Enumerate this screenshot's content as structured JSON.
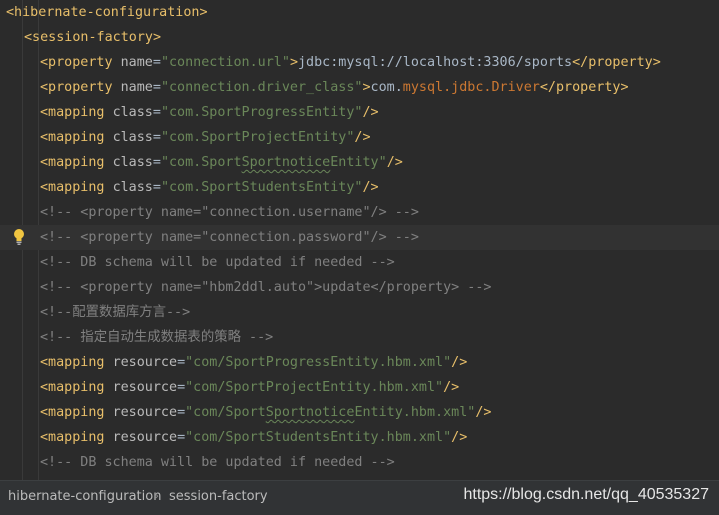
{
  "lines": {
    "l1": {
      "p1": "<hibernate-configuration>"
    },
    "l2": {
      "p1": "<session-factory>"
    },
    "l3": {
      "p1": "<property ",
      "p2": "name",
      "p3": "=",
      "p4": "\"connection.url\"",
      "p5": ">",
      "p6": "jdbc:mysql://localhost:3306/sports",
      "p7": "</property>"
    },
    "l4": {
      "p1": "<property ",
      "p2": "name",
      "p3": "=",
      "p4": "\"connection.driver_class\"",
      "p5": ">",
      "p6": "com.",
      "p7": "mysql.",
      "p8": "jdbc.",
      "p9": "Driver",
      "p10": "</property>"
    },
    "l5": {
      "p1": "<mapping ",
      "p2": "class",
      "p3": "=",
      "p4": "\"com.SportProgressEntity\"",
      "p5": "/>"
    },
    "l6": {
      "p1": "<mapping ",
      "p2": "class",
      "p3": "=",
      "p4": "\"com.SportProjectEntity\"",
      "p5": "/>"
    },
    "l7": {
      "p1": "<mapping ",
      "p2": "class",
      "p3": "=",
      "p4a": "\"com.Sport",
      "p4b": "Sportnotice",
      "p4c": "Entity\"",
      "p5": "/>"
    },
    "l8": {
      "p1": "<mapping ",
      "p2": "class",
      "p3": "=",
      "p4": "\"com.SportStudentsEntity\"",
      "p5": "/>"
    },
    "l9": {
      "p1": "<!-- <property name=\"connection.username\"/> -->"
    },
    "l10": {
      "p1": "<!-- <property name=\"connection.password\"/> -->"
    },
    "l11": {
      "p1": "<!-- DB schema will be updated if needed -->"
    },
    "l12": {
      "p1": "<!-- <property name=\"hbm2ddl.auto\">update</property> -->"
    },
    "l13": {
      "p1": "<!--",
      "p2": "配置数据库方言",
      "p3": "-->"
    },
    "l14": {
      "p1": "<!-- ",
      "p2": "指定自动生成数据表的策略",
      "p3": " -->"
    },
    "l15": {
      "p1": "<mapping ",
      "p2": "resource",
      "p3": "=",
      "p4": "\"com/SportProgressEntity.hbm.xml\"",
      "p5": "/>"
    },
    "l16": {
      "p1": "<mapping ",
      "p2": "resource",
      "p3": "=",
      "p4": "\"com/SportProjectEntity.hbm.xml\"",
      "p5": "/>"
    },
    "l17": {
      "p1": "<mapping ",
      "p2": "resource",
      "p3": "=",
      "p4a": "\"com/Sport",
      "p4b": "Sportnotice",
      "p4c": "Entity.hbm.xml\"",
      "p5": "/>"
    },
    "l18": {
      "p1": "<mapping ",
      "p2": "resource",
      "p3": "=",
      "p4": "\"com/SportStudentsEntity.hbm.xml\"",
      "p5": "/>"
    },
    "l19": {
      "p1": "<!-- DB schema will be updated if needed -->"
    }
  },
  "breadcrumb": {
    "item1": "hibernate-configuration",
    "separator": "›",
    "item2": "session-factory"
  },
  "watermark": "https://blog.csdn.net/qq_40535327",
  "icons": {
    "bulb": "lightbulb-icon"
  },
  "colors": {
    "background": "#2b2b2b",
    "tag": "#e8bf6a",
    "string": "#6a8759",
    "comment": "#808080",
    "text": "#a9b7c6",
    "keyword": "#cc7832"
  }
}
